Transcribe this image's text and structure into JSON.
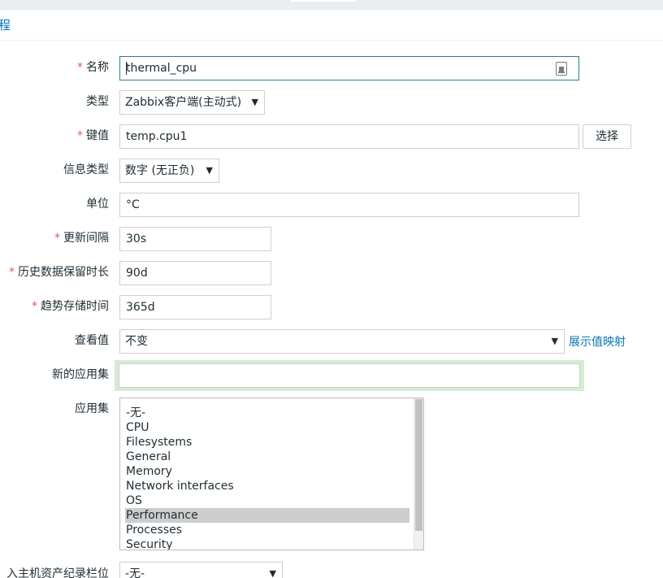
{
  "breadcrumb": "程",
  "form": {
    "name": {
      "label": "名称",
      "value": "thermal_cpu"
    },
    "type": {
      "label": "类型",
      "selected": "Zabbix客户端(主动式)"
    },
    "key": {
      "label": "键值",
      "value": "temp.cpu1",
      "button": "选择"
    },
    "info_type": {
      "label": "信息类型",
      "selected": "数字 (无正负)"
    },
    "units": {
      "label": "单位",
      "value": "°C"
    },
    "update_interval": {
      "label": "更新间隔",
      "value": "30s"
    },
    "history": {
      "label": "历史数据保留时长",
      "value": "90d"
    },
    "trends": {
      "label": "趋势存储时间",
      "value": "365d"
    },
    "value_map": {
      "label": "查看值",
      "selected": "不变",
      "link": "展示值映射"
    },
    "new_application": {
      "label": "新的应用集",
      "value": ""
    },
    "applications": {
      "label": "应用集",
      "options": [
        "-无-",
        "CPU",
        "Filesystems",
        "General",
        "Memory",
        "Network interfaces",
        "OS",
        "Performance",
        "Processes",
        "Security"
      ],
      "selected": "Performance"
    },
    "inventory": {
      "label": "入主机资产纪录栏位",
      "selected": "-无-"
    }
  },
  "colors": {
    "link": "#0275b8",
    "required": "#e45959",
    "focus_border": "#2f7d8c",
    "highlight": "#d4ecd4"
  }
}
